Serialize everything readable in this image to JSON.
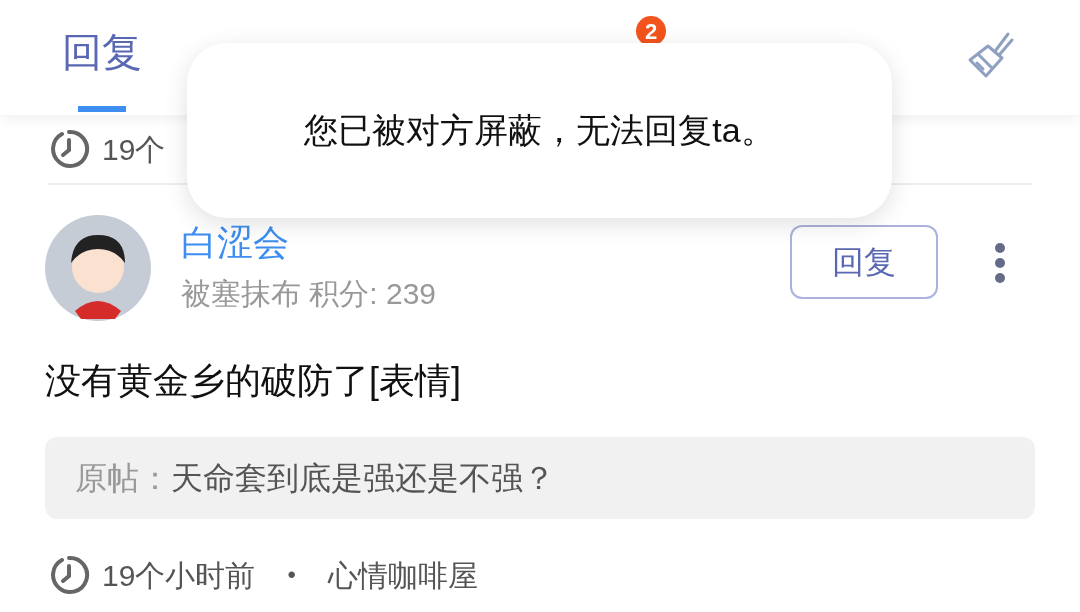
{
  "tabs": [
    {
      "label": "回复",
      "selected": true
    }
  ],
  "message_badge": "2",
  "previous_item": {
    "time": "19个"
  },
  "post": {
    "author": "白涩会",
    "subtitle": "被塞抹布 积分: 239",
    "reply_button": "回复",
    "content": "没有黄金乡的破防了[表情]",
    "quote": {
      "label": "原帖：",
      "text": "天命套到底是强还是不强？"
    },
    "time": "19个小时前",
    "separator": "•",
    "board": "心情咖啡屋"
  },
  "toast": {
    "message": "您已被对方屏蔽，无法回复ta。"
  }
}
